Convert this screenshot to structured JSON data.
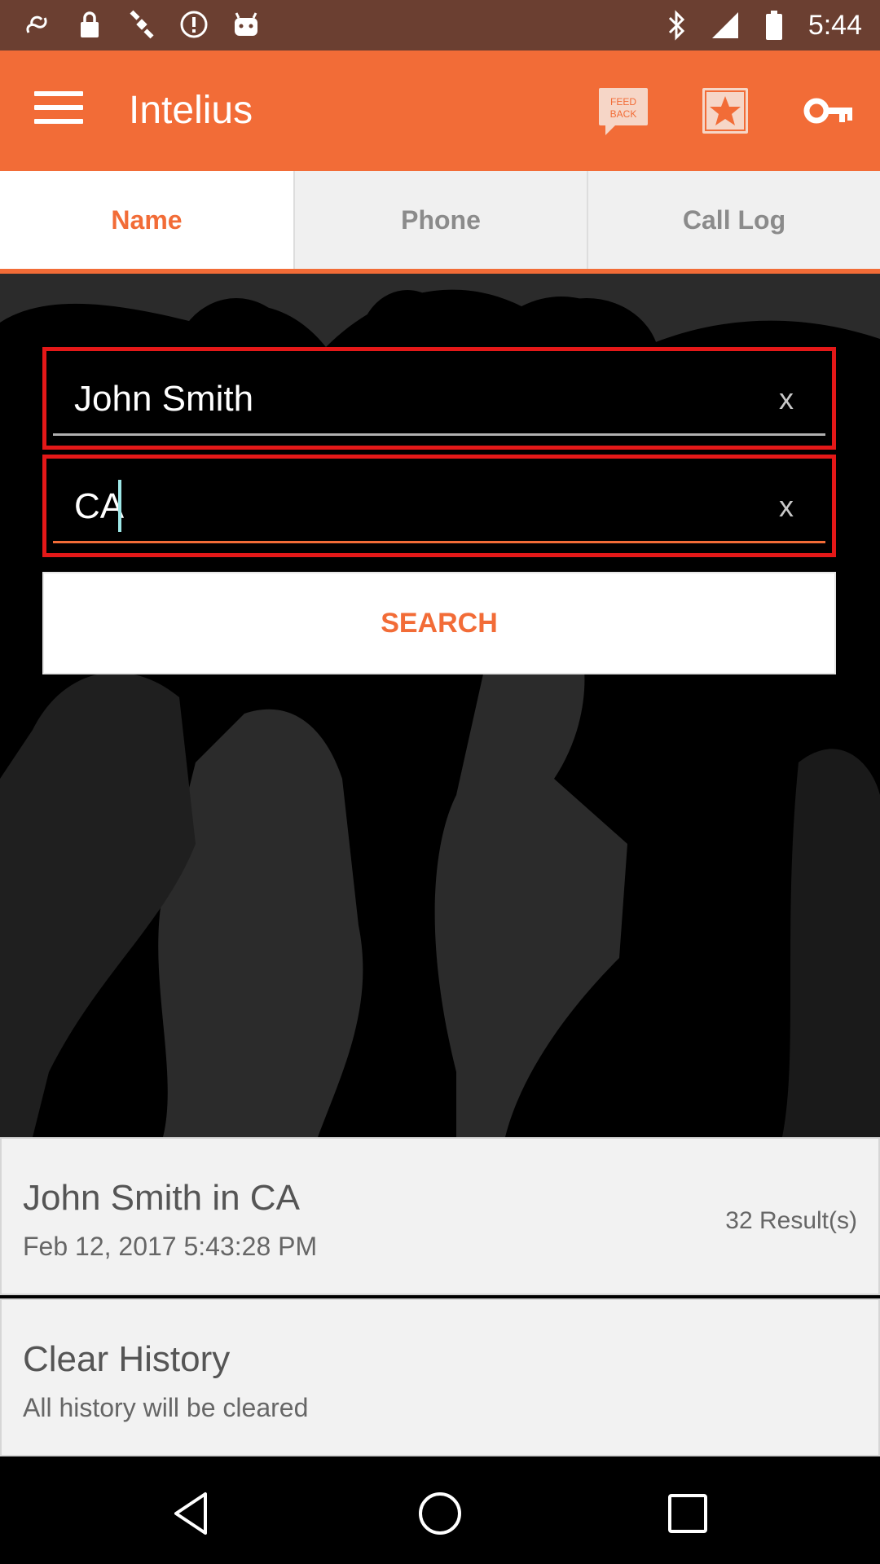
{
  "status_bar": {
    "time": "5:44",
    "icons": [
      "notification-icon",
      "lock-icon",
      "satellite-icon",
      "alert-icon",
      "android-icon",
      "bluetooth-icon",
      "signal-icon",
      "battery-icon"
    ]
  },
  "app_bar": {
    "title": "Intelius",
    "feedback_label": "FEED BACK",
    "brand_color": "#f26c37"
  },
  "tabs": [
    {
      "label": "Name",
      "active": true
    },
    {
      "label": "Phone",
      "active": false
    },
    {
      "label": "Call Log",
      "active": false
    }
  ],
  "form": {
    "name_value": "John Smith",
    "state_value": "CA",
    "clear_label": "x",
    "search_label": "SEARCH"
  },
  "history": [
    {
      "title": "John Smith in CA",
      "subtitle": "Feb 12, 2017 5:43:28 PM",
      "count": "32 Result(s)"
    },
    {
      "title": "Clear History",
      "subtitle": "All history will be cleared",
      "count": ""
    }
  ]
}
